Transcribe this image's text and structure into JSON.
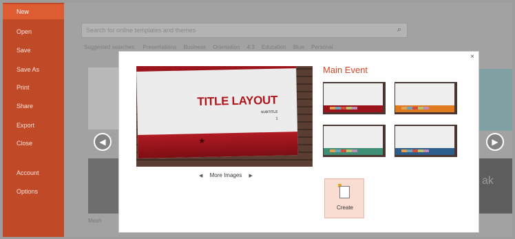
{
  "sidebar": {
    "items": [
      {
        "label": "New"
      },
      {
        "label": "Open"
      },
      {
        "label": "Save"
      },
      {
        "label": "Save As"
      },
      {
        "label": "Print"
      },
      {
        "label": "Share"
      },
      {
        "label": "Export"
      },
      {
        "label": "Close"
      },
      {
        "label": "Account"
      },
      {
        "label": "Options"
      }
    ]
  },
  "search": {
    "placeholder": "Search for online templates and themes",
    "icon": "search-icon"
  },
  "suggested": {
    "label": "Suggested searches:",
    "items": [
      "Presentations",
      "Business",
      "Orientation",
      "4:3",
      "Education",
      "Blue",
      "Personal"
    ]
  },
  "background": {
    "mesh_label": "Mesh",
    "right_fragment": "ak"
  },
  "dialog": {
    "close_glyph": "×",
    "preview": {
      "title": "TITLE LAYOUT",
      "subtitle": "SUBTITLE",
      "number": "1"
    },
    "more_images_label": "More Images",
    "variant_title": "Main Event",
    "create_label": "Create"
  },
  "colors": {
    "accent": "#d24726",
    "sidebar": "#c04a27",
    "sidebar_active": "#dd5c32",
    "variant_bands": [
      "#9b141c",
      "#e07a1e",
      "#3f8f76",
      "#2c5f8c"
    ]
  }
}
